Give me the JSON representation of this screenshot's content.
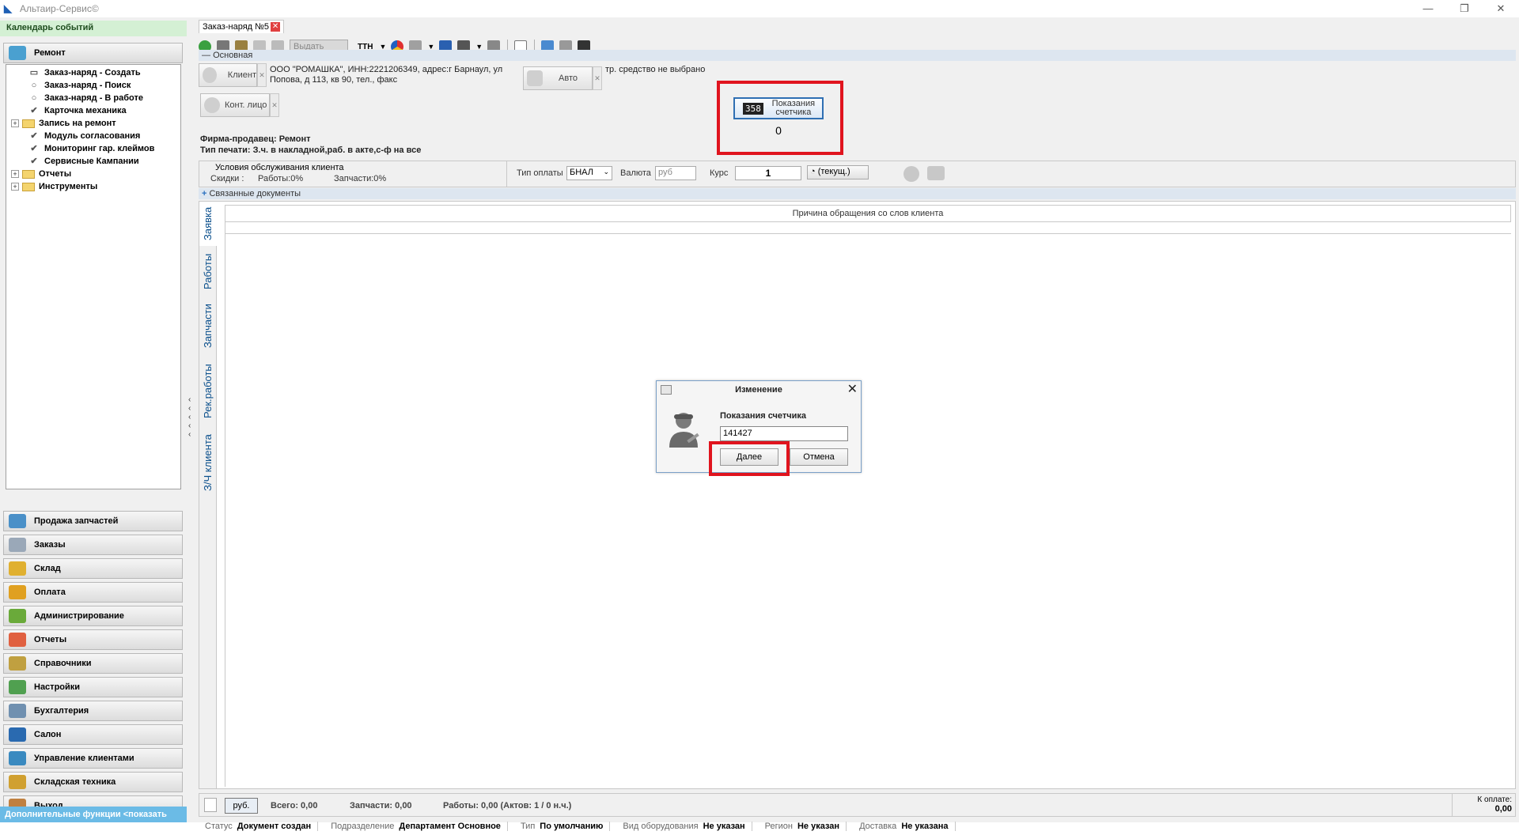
{
  "window": {
    "title": "Альтаир-Сервис©",
    "controls": [
      "—",
      "❐",
      "✕"
    ]
  },
  "sidebar": {
    "calendar": "Календарь событий",
    "repair_section": "Ремонт",
    "tree": [
      {
        "label": "Заказ-наряд - Создать",
        "icon": "document-icon",
        "expandable": false
      },
      {
        "label": "Заказ-наряд - Поиск",
        "icon": "search-circle-icon",
        "expandable": false
      },
      {
        "label": "Заказ-наряд - В работе",
        "icon": "circle-icon",
        "expandable": false
      },
      {
        "label": "Карточка механика",
        "icon": "check-icon",
        "expandable": false
      },
      {
        "label": "Запись на ремонт",
        "icon": "folder-icon",
        "expandable": true
      },
      {
        "label": "Модуль согласования",
        "icon": "check-icon",
        "expandable": false
      },
      {
        "label": "Мониторинг гар. клеймов",
        "icon": "check-icon",
        "expandable": false
      },
      {
        "label": "Сервисные Кампании",
        "icon": "check-icon",
        "expandable": false
      },
      {
        "label": "Отчеты",
        "icon": "folder-icon",
        "expandable": true
      },
      {
        "label": "Инструменты",
        "icon": "folder-icon",
        "expandable": true
      }
    ],
    "sections": [
      {
        "label": "Продажа запчастей",
        "icon": "gears-icon",
        "color": "#4a90c8"
      },
      {
        "label": "Заказы",
        "icon": "pen-icon",
        "color": "#9aa8b8"
      },
      {
        "label": "Склад",
        "icon": "coins-icon",
        "color": "#e0b030"
      },
      {
        "label": "Оплата",
        "icon": "money-icon",
        "color": "#e0a020"
      },
      {
        "label": "Администрирование",
        "icon": "clipboard-icon",
        "color": "#6aaa3a"
      },
      {
        "label": "Отчеты",
        "icon": "report-icon",
        "color": "#e06040"
      },
      {
        "label": "Справочники",
        "icon": "books-icon",
        "color": "#c0a040"
      },
      {
        "label": "Настройки",
        "icon": "settings-icon",
        "color": "#50a050"
      },
      {
        "label": "Бухгалтерия",
        "icon": "ledger-icon",
        "color": "#7090b0"
      },
      {
        "label": "Салон",
        "icon": "car-icon",
        "color": "#2a6ab0"
      },
      {
        "label": "Управление клиентами",
        "icon": "clients-icon",
        "color": "#3a8ac0"
      },
      {
        "label": "Складская техника",
        "icon": "forklift-icon",
        "color": "#d0a030"
      },
      {
        "label": "Выход",
        "icon": "exit-icon",
        "color": "#c08040"
      }
    ],
    "extra_functions": "Дополнительные функции <показать"
  },
  "document_tab": {
    "label": "Заказ-наряд №5",
    "close": "✕"
  },
  "toolbar": {
    "vydat": "Выдать",
    "ttn": "ТТН"
  },
  "main_group": {
    "header": "Основная",
    "client_button": "Клиент",
    "client_info": "ООО \"РОМАШКА\", ИНН:2221206349, адрес:г Барнаул, ул Попова, д 113, кв 90, тел., факс",
    "auto_button": "Авто",
    "auto_info": "тр. средство не выбрано",
    "contact_button": "Конт. лицо",
    "firm_seller": "Фирма-продавец: Ремонт",
    "print_type": "Тип печати: З.ч. в накладной,раб. в акте,с-ф на все",
    "counter_button": "Показания счетчика",
    "counter_icon_text": "358",
    "counter_value": "0"
  },
  "conditions": {
    "title": "Условия обслуживания клиента",
    "discounts": "Скидки :",
    "works": "Работы:0%",
    "parts": "Запчасти:0%",
    "pay_type_label": "Тип оплаты",
    "pay_type_value": "БНАЛ",
    "currency_label": "Валюта",
    "currency_value": "руб",
    "rate_label": "Курс",
    "rate_value": "1",
    "current_button": "(текущ.)"
  },
  "related_docs": "Связанные документы",
  "vtabs": [
    "Заявка",
    "Работы",
    "Запчасти",
    "Рек.работы",
    "З/Ч клиента"
  ],
  "grid": {
    "column_header": "Причина обращения со слов клиента"
  },
  "totals": {
    "currency_btn": "руб.",
    "total": "Всего: 0,00",
    "parts": "Запчасти: 0,00",
    "works": "Работы: 0,00 (Актов: 1 / 0 н.ч.)",
    "to_pay_label": "К оплате:",
    "to_pay_value": "0,00"
  },
  "status": [
    {
      "label": "Статус",
      "value": "Документ создан"
    },
    {
      "label": "Подразделение",
      "value": "Департамент Основное"
    },
    {
      "label": "Тип",
      "value": "По умолчанию"
    },
    {
      "label": "Вид оборудования",
      "value": "Не указан"
    },
    {
      "label": "Регион",
      "value": "Не указан"
    },
    {
      "label": "Доставка",
      "value": "Не указана"
    }
  ],
  "dialog": {
    "title": "Изменение",
    "label": "Показания счетчика",
    "value": "141427",
    "next": "Далее",
    "cancel": "Отмена"
  },
  "colors": {
    "highlight": "#e0141e",
    "accent": "#2f6fb3",
    "calendar_bg": "#d4f0d4",
    "extra_bar": "#6bbbe6"
  }
}
